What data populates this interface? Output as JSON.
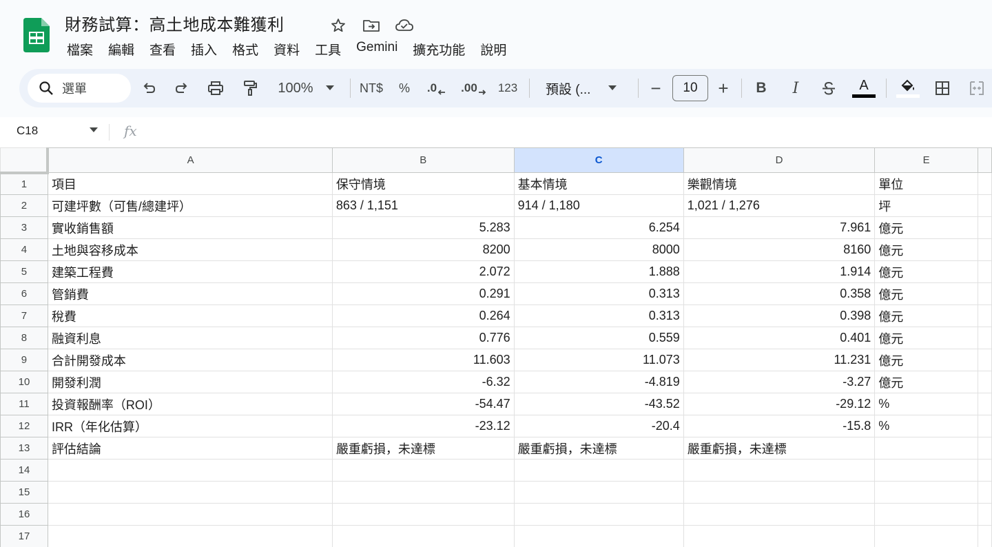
{
  "app": {
    "doc_title": "財務試算：高土地成本難獲利",
    "brand_color": "#0f9d58"
  },
  "menu": [
    "檔案",
    "編輯",
    "查看",
    "插入",
    "格式",
    "資料",
    "工具",
    "Gemini",
    "擴充功能",
    "說明"
  ],
  "toolbar": {
    "search_label": "選單",
    "zoom": "100%",
    "currency": "NT$",
    "percent": "%",
    "dec_decrease": ".0",
    "dec_increase": ".00",
    "number_format": "123",
    "font": "預設 (...",
    "font_size": "10",
    "minus": "−",
    "plus": "+",
    "bold": "B",
    "italic": "I",
    "text_color_glyph": "A"
  },
  "formula_bar": {
    "cell_ref": "C18",
    "fx": "fx"
  },
  "sheet": {
    "columns": [
      "A",
      "B",
      "C",
      "D",
      "E"
    ],
    "selected_column": "C",
    "rows": [
      {
        "n": "1",
        "cells": [
          "項目",
          "保守情境",
          "基本情境",
          "樂觀情境",
          "單位"
        ],
        "align": [
          "l",
          "l",
          "l",
          "l",
          "l"
        ]
      },
      {
        "n": "2",
        "cells": [
          "可建坪數（可售/總建坪）",
          "863 / 1,151",
          "914 / 1,180",
          "1,021 / 1,276",
          "坪"
        ],
        "align": [
          "l",
          "l",
          "l",
          "l",
          "l"
        ]
      },
      {
        "n": "3",
        "cells": [
          "實收銷售額",
          "5.283",
          "6.254",
          "7.961",
          "億元"
        ],
        "align": [
          "l",
          "r",
          "r",
          "r",
          "l"
        ]
      },
      {
        "n": "4",
        "cells": [
          "土地與容移成本",
          "8200",
          "8000",
          "8160",
          "億元"
        ],
        "align": [
          "l",
          "r",
          "r",
          "r",
          "l"
        ]
      },
      {
        "n": "5",
        "cells": [
          "建築工程費",
          "2.072",
          "1.888",
          "1.914",
          "億元"
        ],
        "align": [
          "l",
          "r",
          "r",
          "r",
          "l"
        ]
      },
      {
        "n": "6",
        "cells": [
          "管銷費",
          "0.291",
          "0.313",
          "0.358",
          "億元"
        ],
        "align": [
          "l",
          "r",
          "r",
          "r",
          "l"
        ]
      },
      {
        "n": "7",
        "cells": [
          "稅費",
          "0.264",
          "0.313",
          "0.398",
          "億元"
        ],
        "align": [
          "l",
          "r",
          "r",
          "r",
          "l"
        ]
      },
      {
        "n": "8",
        "cells": [
          "融資利息",
          "0.776",
          "0.559",
          "0.401",
          "億元"
        ],
        "align": [
          "l",
          "r",
          "r",
          "r",
          "l"
        ]
      },
      {
        "n": "9",
        "cells": [
          "合計開發成本",
          "11.603",
          "11.073",
          "11.231",
          "億元"
        ],
        "align": [
          "l",
          "r",
          "r",
          "r",
          "l"
        ]
      },
      {
        "n": "10",
        "cells": [
          "開發利潤",
          "-6.32",
          "-4.819",
          "-3.27",
          "億元"
        ],
        "align": [
          "l",
          "r",
          "r",
          "r",
          "l"
        ]
      },
      {
        "n": "11",
        "cells": [
          "投資報酬率（ROI）",
          "-54.47",
          "-43.52",
          "-29.12",
          "%"
        ],
        "align": [
          "l",
          "r",
          "r",
          "r",
          "l"
        ]
      },
      {
        "n": "12",
        "cells": [
          "IRR（年化估算）",
          "-23.12",
          "-20.4",
          "-15.8",
          "%"
        ],
        "align": [
          "l",
          "r",
          "r",
          "r",
          "l"
        ]
      },
      {
        "n": "13",
        "cells": [
          "評估結論",
          "嚴重虧損，未達標",
          "嚴重虧損，未達標",
          "嚴重虧損，未達標",
          ""
        ],
        "align": [
          "l",
          "l",
          "l",
          "l",
          "l"
        ]
      },
      {
        "n": "14",
        "cells": [
          "",
          "",
          "",
          "",
          ""
        ],
        "align": [
          "l",
          "l",
          "l",
          "l",
          "l"
        ]
      },
      {
        "n": "15",
        "cells": [
          "",
          "",
          "",
          "",
          ""
        ],
        "align": [
          "l",
          "l",
          "l",
          "l",
          "l"
        ]
      },
      {
        "n": "16",
        "cells": [
          "",
          "",
          "",
          "",
          ""
        ],
        "align": [
          "l",
          "l",
          "l",
          "l",
          "l"
        ]
      },
      {
        "n": "17",
        "cells": [
          "",
          "",
          "",
          "",
          ""
        ],
        "align": [
          "l",
          "l",
          "l",
          "l",
          "l"
        ]
      }
    ]
  }
}
